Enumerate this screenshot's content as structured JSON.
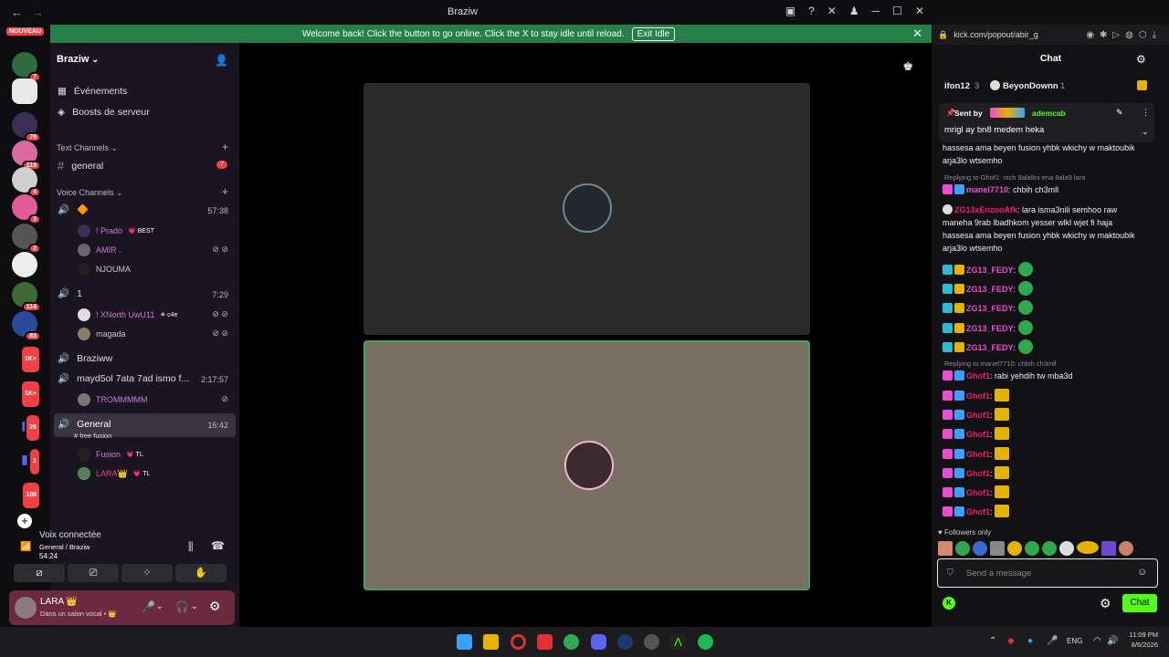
{
  "window": {
    "title": "Braziw"
  },
  "banner": {
    "text": "Welcome back! Click the button to go online. Click the X to stay idle until reload.",
    "button": "Exit Idle"
  },
  "rail": {
    "nouveau": "NOUVEAU",
    "badges": [
      "7",
      "76",
      "119",
      "4",
      "3",
      "2",
      "114",
      "83",
      "1K+",
      "1K+",
      "26",
      "1",
      "108"
    ]
  },
  "server": {
    "name": "Braziw",
    "events": "Événements",
    "boosts": "Boosts de serveur"
  },
  "text_channels": {
    "label": "Text Channels",
    "items": [
      {
        "name": "general",
        "badge": "7"
      }
    ]
  },
  "voice_channels": {
    "label": "Voice Channels",
    "channels": [
      {
        "name": "🔶",
        "time": "57:38",
        "users": [
          {
            "name": "! Prado",
            "tag": "💗 BEST"
          },
          {
            "name": "AMIR .",
            "tag": ""
          },
          {
            "name": "NJOUMA",
            "tag": ""
          }
        ]
      },
      {
        "name": "1",
        "time": "7:29",
        "users": [
          {
            "name": "! XNorth UwU11",
            "tag": "✳ c4e"
          },
          {
            "name": "magada",
            "tag": ""
          }
        ]
      },
      {
        "name": "Braziww",
        "time": "",
        "users": []
      },
      {
        "name": "mayd5ol 7ata 7ad ismo f...",
        "time": "2:17:57",
        "users": [
          {
            "name": "TROMMMMM",
            "tag": ""
          }
        ]
      },
      {
        "name": "General",
        "sub": "# free fusion",
        "time": "16:42",
        "users": [
          {
            "name": "Fusion",
            "tag": "💗 TL"
          },
          {
            "name": "LARA👑",
            "tag": "💗 TL"
          }
        ]
      }
    ]
  },
  "voice_panel": {
    "status": "Voix connectée",
    "location": "General / Braziw",
    "timer": "54:24"
  },
  "user_panel": {
    "name": "LARA 👑",
    "status": "Dans un salon vocal • 👑"
  },
  "chat": {
    "url": "kick.com/popout/abir_g",
    "title": "Chat",
    "top_users": [
      {
        "name": "ifon12",
        "count": "3"
      },
      {
        "name": "BeyonDownn",
        "count": "1"
      }
    ],
    "pinned": {
      "sent_by_label": "Sent by",
      "sender": "ademcab",
      "text": "mrigl ay bn8 medem heka"
    },
    "messages": [
      {
        "text": "hassesa ama beyen fusion yhbk wkichy w maktoubik arja3lo wtsemho"
      },
      {
        "reply": "Replying to Ghof1: mch 9ala9ni ena 9ala9 lara",
        "name": "manel7710",
        "text": "chbih ch3mll"
      },
      {
        "name": "ZG13xEnzooAfk",
        "text": "lara isma3nili semhoo raw maneha 9rab lbadhkom yesser wlkl wjet fi haja hassesa ama beyen fusion yhbk wkichy w maktoubik arja3lo wtsemho"
      },
      {
        "name": "ZG13_FEDY",
        "text": ""
      },
      {
        "name": "ZG13_FEDY",
        "text": ""
      },
      {
        "name": "ZG13_FEDY",
        "text": ""
      },
      {
        "name": "ZG13_FEDY",
        "text": ""
      },
      {
        "name": "ZG13_FEDY",
        "text": ""
      },
      {
        "reply": "Replying to manel7710: chbih ch3mll",
        "name": "Ghof1",
        "text": "rabi yehdih tw mba3d"
      },
      {
        "name": "Ghof1",
        "text": ""
      },
      {
        "name": "Ghof1",
        "text": ""
      },
      {
        "name": "Ghof1",
        "text": ""
      },
      {
        "name": "Ghof1",
        "text": ""
      },
      {
        "name": "Ghof1",
        "text": ""
      },
      {
        "name": "Ghof1",
        "text": ""
      },
      {
        "name": "Ghof1",
        "text": ""
      }
    ],
    "followers_only": "Followers only",
    "input_placeholder": "Send a message",
    "send_button": "Chat"
  },
  "taskbar": {
    "lang": "ENG",
    "time": "11:09 PM",
    "date": "8/6/2026"
  }
}
